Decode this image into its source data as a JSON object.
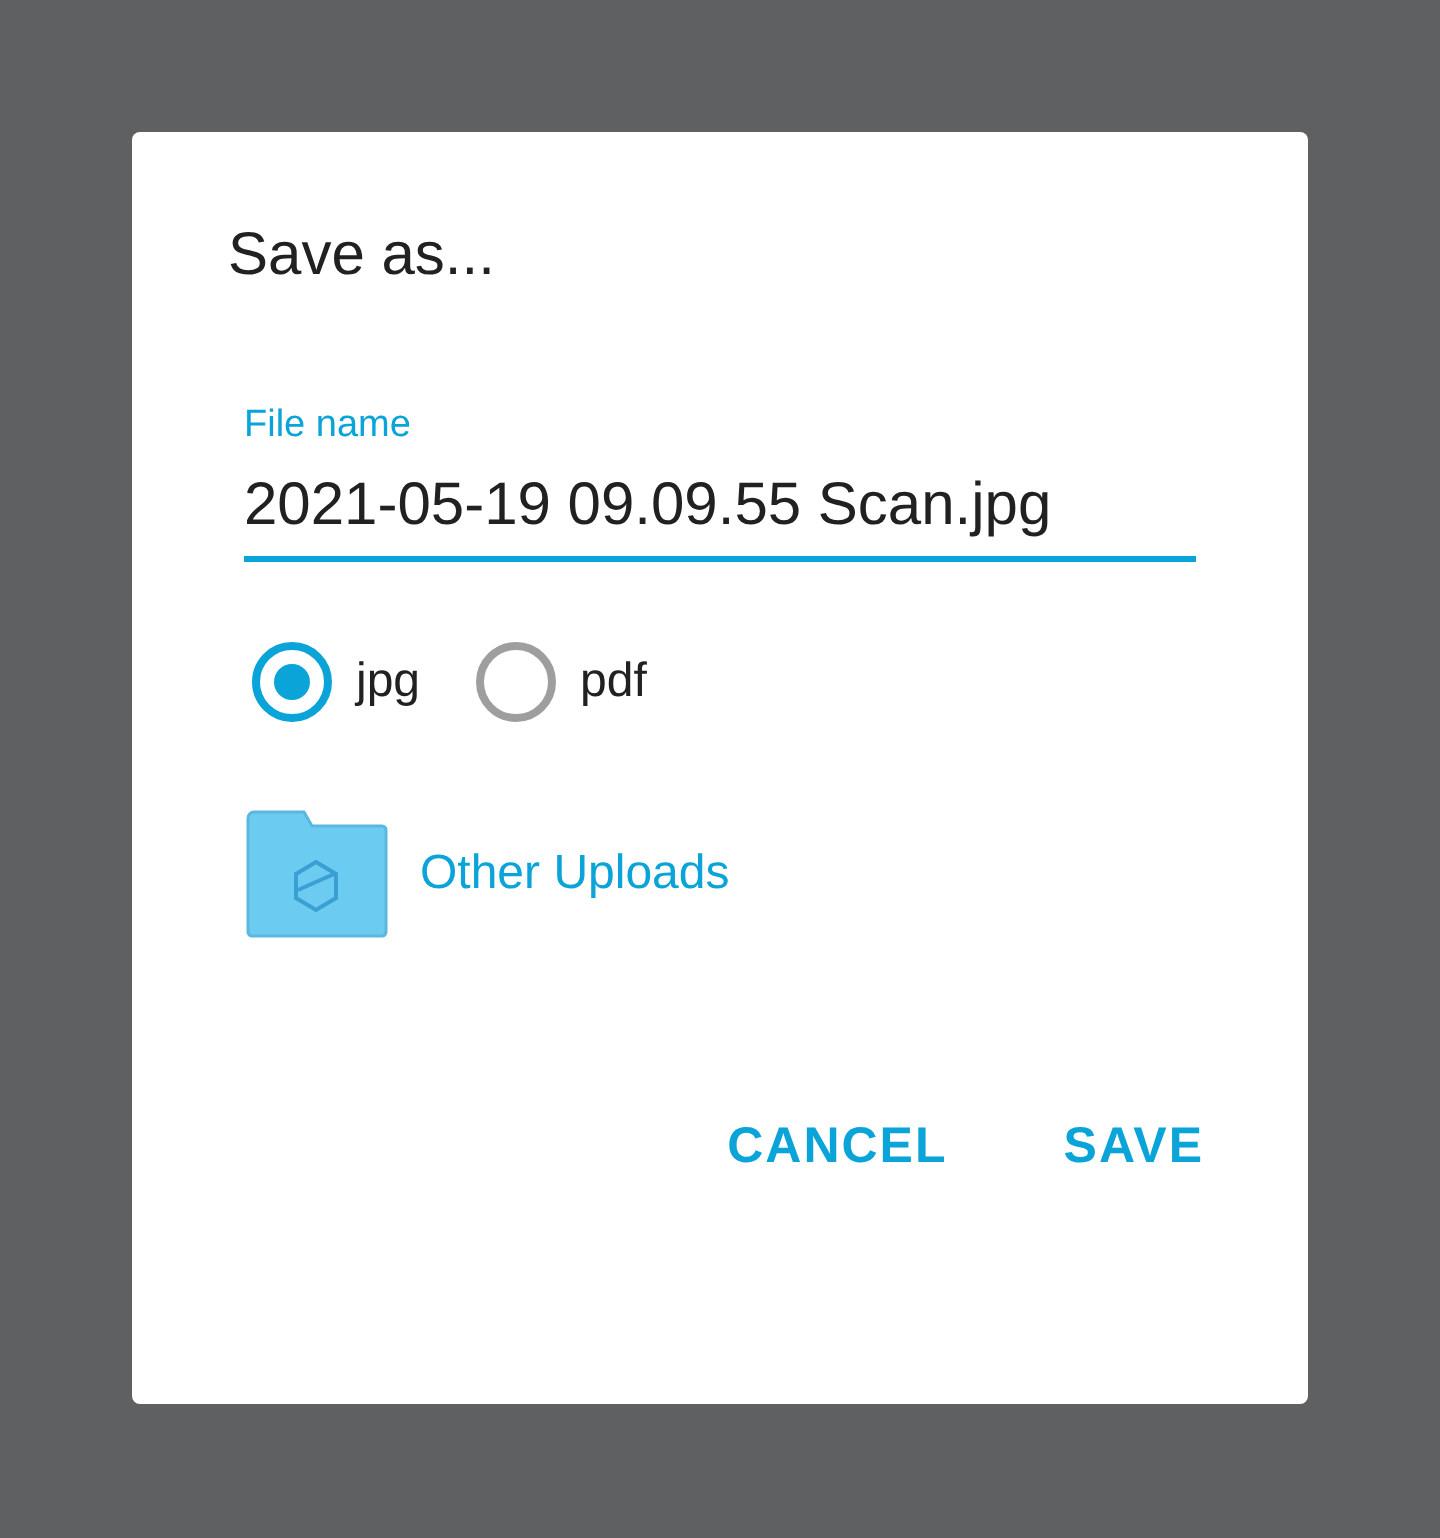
{
  "dialog": {
    "title": "Save as...",
    "file_name": {
      "label": "File name",
      "value": "2021-05-19 09.09.55 Scan.jpg"
    },
    "formats": [
      {
        "label": "jpg",
        "selected": true
      },
      {
        "label": "pdf",
        "selected": false
      }
    ],
    "folder": {
      "label": "Other Uploads"
    },
    "buttons": [
      {
        "label": "CANCEL"
      },
      {
        "label": "SAVE"
      }
    ]
  }
}
